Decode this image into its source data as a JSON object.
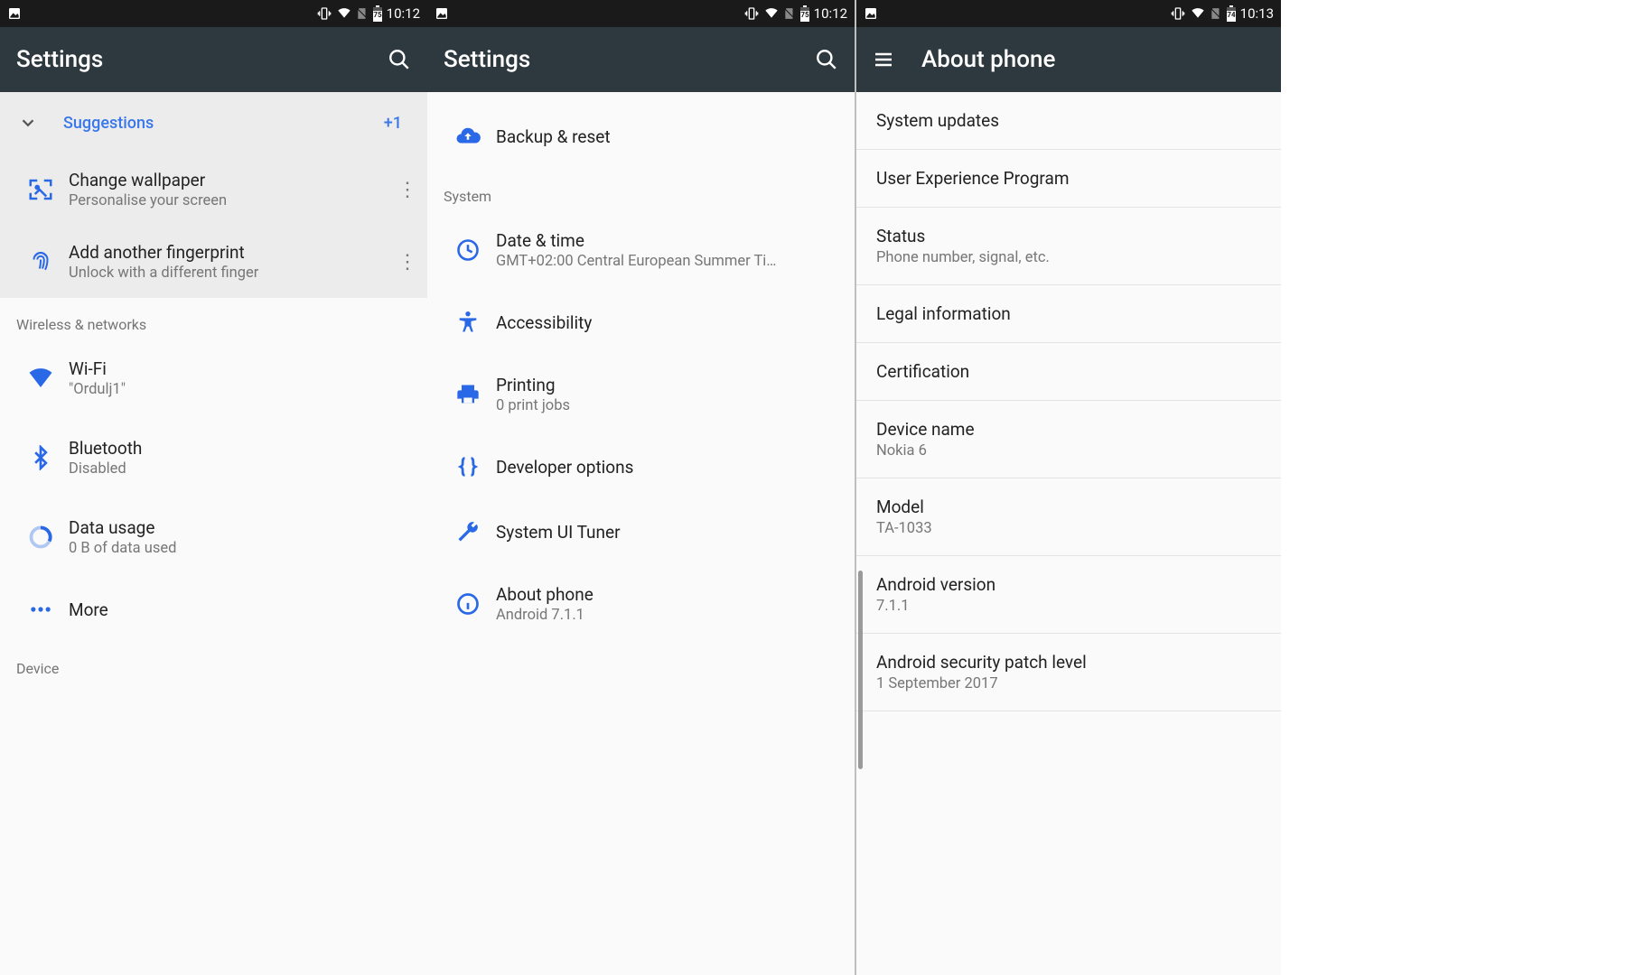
{
  "panel1": {
    "status": {
      "time": "10:12",
      "battery": "75"
    },
    "appbar": {
      "title": "Settings"
    },
    "suggestions": {
      "header": "Suggestions",
      "overflow_badge": "+1",
      "items": [
        {
          "title": "Change wallpaper",
          "sub": "Personalise your screen"
        },
        {
          "title": "Add another fingerprint",
          "sub": "Unlock with a different finger"
        }
      ]
    },
    "section_wireless": "Wireless & networks",
    "wireless": [
      {
        "title": "Wi-Fi",
        "sub": "\"Ordulj1\""
      },
      {
        "title": "Bluetooth",
        "sub": "Disabled"
      },
      {
        "title": "Data usage",
        "sub": "0 B of data used"
      },
      {
        "title": "More",
        "sub": ""
      }
    ],
    "section_device": "Device"
  },
  "panel2": {
    "status": {
      "time": "10:12",
      "battery": "75"
    },
    "appbar": {
      "title": "Settings"
    },
    "top_item": {
      "title": "Backup & reset",
      "sub": ""
    },
    "section_system": "System",
    "system": [
      {
        "title": "Date & time",
        "sub": "GMT+02:00 Central European Summer Ti…"
      },
      {
        "title": "Accessibility",
        "sub": ""
      },
      {
        "title": "Printing",
        "sub": "0 print jobs"
      },
      {
        "title": "Developer options",
        "sub": ""
      },
      {
        "title": "System UI Tuner",
        "sub": ""
      },
      {
        "title": "About phone",
        "sub": "Android 7.1.1"
      }
    ]
  },
  "panel3": {
    "status": {
      "time": "10:13",
      "battery": "74"
    },
    "appbar": {
      "title": "About phone"
    },
    "items": [
      {
        "title": "System updates",
        "sub": ""
      },
      {
        "title": "User Experience Program",
        "sub": ""
      },
      {
        "title": "Status",
        "sub": "Phone number, signal, etc."
      },
      {
        "title": "Legal information",
        "sub": ""
      },
      {
        "title": "Certification",
        "sub": ""
      },
      {
        "title": "Device name",
        "sub": "Nokia 6"
      },
      {
        "title": "Model",
        "sub": "TA-1033"
      },
      {
        "title": "Android version",
        "sub": "7.1.1"
      },
      {
        "title": "Android security patch level",
        "sub": "1 September 2017"
      }
    ]
  }
}
